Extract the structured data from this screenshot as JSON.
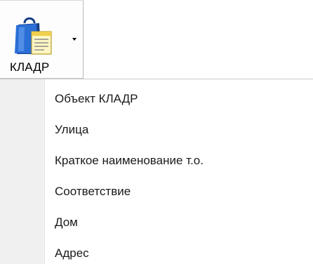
{
  "ribbon": {
    "button": {
      "label": "КЛАДР",
      "icon": "shopping-bag-document-icon",
      "dropdown_icon": "dropdown-arrow-icon"
    }
  },
  "menu": {
    "items": [
      {
        "label": "Объект КЛАДР"
      },
      {
        "label": "Улица"
      },
      {
        "label": "Краткое наименование т.о."
      },
      {
        "label": "Соответствие"
      },
      {
        "label": "Дом"
      },
      {
        "label": "Адрес"
      }
    ]
  },
  "colors": {
    "bag_blue": "#1f5fbf",
    "bag_dark": "#163f86",
    "document_yellow": "#f7e27a",
    "gutter": "#f0f0f0"
  }
}
